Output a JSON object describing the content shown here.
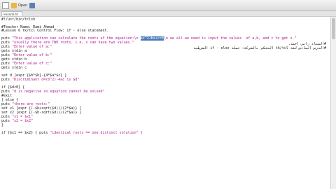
{
  "toolbar": {
    "buttons": [
      {
        "label": "",
        "icon": "new-document-icon"
      },
      {
        "label": "Open",
        "icon": "open-folder-icon"
      },
      {
        "label": "",
        "icon": "save-icon"
      }
    ]
  },
  "tab": {
    "label": "lesson6.tcl"
  },
  "code_lines": [
    {
      "pre": "#!/usr/bin/tclsh",
      "str": "",
      "sel": "",
      "post": ""
    },
    {
      "pre": "#Teacher Name: Rami Ahmad",
      "str": "",
      "sel": "",
      "post": ""
    },
    {
      "pre": "#Lesson 6 tk/tcl Control Flow: if - else statement.",
      "str": "",
      "sel": "",
      "post": ""
    },
    {
      "pre": "puts ",
      "str": "\"This application can calculate the roots of the equation:\\n ",
      "sel": "ax^2+bx+c=0",
      "post": "\\n we all we need is input the values  of a,b, and c to get x.\""
    },
    {
      "pre": "puts ",
      "str": "\"usually there are TWO roots, i.e, x can have two values.\"",
      "sel": "",
      "post": ""
    },
    {
      "pre": "puts ",
      "str": "\"Enter value of a:\"",
      "sel": "",
      "post": ""
    },
    {
      "pre": "gets stdin a",
      "str": "",
      "sel": "",
      "post": ""
    },
    {
      "pre": "puts ",
      "str": "\"Enter value of b:\"",
      "sel": "",
      "post": ""
    },
    {
      "pre": "gets stdin b",
      "str": "",
      "sel": "",
      "post": ""
    },
    {
      "pre": "puts ",
      "str": "\"Enter value of c:\"",
      "sel": "",
      "post": ""
    },
    {
      "pre": "gets stdin c",
      "str": "",
      "sel": "",
      "post": ""
    },
    {
      "pre": "set d [expr {$b*$b}-{4*$a*$c} ]",
      "str": "",
      "sel": "",
      "post": ""
    },
    {
      "pre": "puts ",
      "str": "\"Discriminant d=(b^2)-4ac is $d\"",
      "sel": "",
      "post": ""
    },
    {
      "pre": "if {$d<0} {",
      "str": "",
      "sel": "",
      "post": ""
    },
    {
      "pre": "puts ",
      "str": "\"d is negative so equation cannot be solved\"",
      "sel": "",
      "post": ""
    },
    {
      "pre": "#exit",
      "str": "",
      "sel": "",
      "post": ""
    },
    {
      "pre": "} else {",
      "str": "",
      "sel": "",
      "post": ""
    },
    {
      "pre": "puts ",
      "str": "\"there are roots:\"",
      "sel": "",
      "post": ""
    },
    {
      "pre": "set x1 [expr {(-$b+sqrt($d))/(2*$a)} ]",
      "str": "",
      "sel": "",
      "post": ""
    },
    {
      "pre": "set x2 [expr {(-$b-sqrt($d))/(2*$a)} ]",
      "str": "",
      "sel": "",
      "post": ""
    },
    {
      "pre": "puts ",
      "str": "\"x1 = $x1\"",
      "sel": "",
      "post": ""
    },
    {
      "pre": "puts ",
      "str": "\"x2 = $x2\"",
      "sel": "",
      "post": ""
    },
    {
      "pre": "}",
      "str": "",
      "sel": "",
      "post": ""
    },
    {
      "pre": "if {$x1 == $x2} { puts ",
      "str": "\"identical roots == one distinct solution\"",
      "sel": "",
      "post": " }"
    }
  ],
  "rtl_lines": [
    "#الستاذ رامي احمد.",
    "#الدرس السادس لغة tk/tcl التحكم بالشركة: جملة if - else الشرطية"
  ],
  "colors": {
    "string": "#b0158b",
    "selection": "#4a78b8"
  }
}
